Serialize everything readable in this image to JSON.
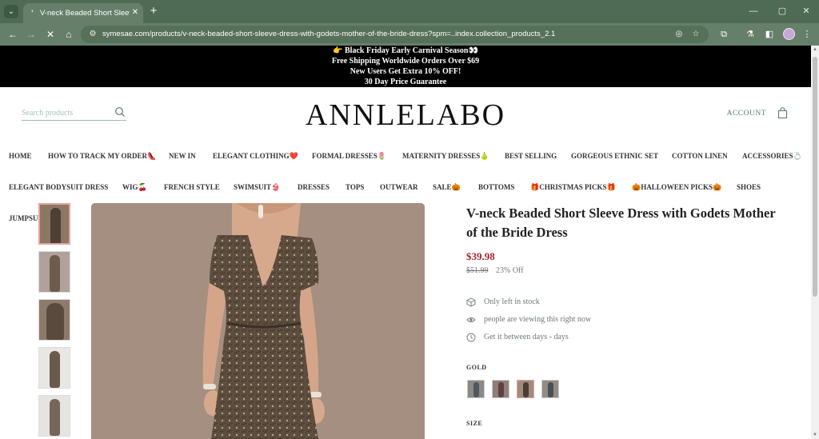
{
  "browser": {
    "tab_title": "V-neck Beaded Short Sleeve Dress",
    "url": "symesae.com/products/v-neck-beaded-short-sleeve-dress-with-godets-mother-of-the-bride-dress?spm=..index.collection_products_2.1"
  },
  "announcement": {
    "lines": [
      "👉 Black Friday Early Carnival Season👀",
      "Free Shipping Worldwide Orders Over $69",
      "New Users Get Extra 10% OFF!",
      "30 Day Price Guarantee"
    ]
  },
  "header": {
    "search_placeholder": "Search products",
    "logo": "ANNLELABO",
    "account_label": "ACCOUNT"
  },
  "nav": {
    "row1": [
      "HOME",
      "HOW TO TRACK MY ORDER👠",
      "NEW IN",
      "ELEGANT CLOTHING❤️",
      "FORMAL DRESSES🌷",
      "MATERNITY DRESSES🍐",
      "BEST SELLING",
      "GORGEOUS ETHNIC SET",
      "COTTON LINEN",
      "ACCESSORIES💍"
    ],
    "row2": [
      "ELEGANT BODYSUIT DRESS",
      "WIG🍒",
      "FRENCH STYLE",
      "SWIMSUIT👙",
      "DRESSES",
      "TOPS",
      "OUTWEAR",
      "SALE🎃",
      "BOTTOMS",
      "🎁CHRISTMAS PICKS🎁",
      "🎃HALLOWEEN PICKS🎃",
      "SHOES"
    ],
    "row3": [
      "JUMPSUITS"
    ]
  },
  "product": {
    "title": "V-neck Beaded Short Sleeve Dress with Godets Mother of the Bride Dress",
    "price": "$39.98",
    "compare_price": "$51.99",
    "discount": "23% Off",
    "stock_text": "Only left in stock",
    "viewers_text": "people are viewing this right now",
    "delivery_text": "Get it between days - days",
    "color_label": "GOLD",
    "size_label": "SIZE"
  },
  "colors": {
    "accent_red": "#a6262c",
    "chrome_green": "#667f6b",
    "link_green": "#5d7a6a"
  }
}
